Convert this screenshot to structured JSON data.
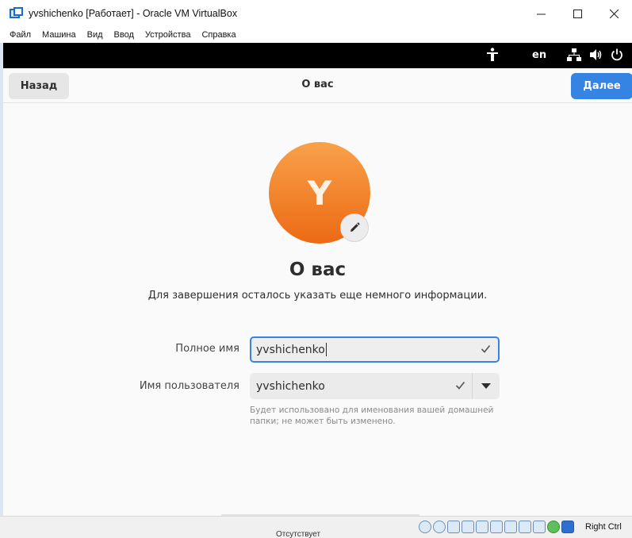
{
  "window": {
    "title": "yvshichenko [Работает] - Oracle VM VirtualBox",
    "controls": [
      "minimize",
      "maximize",
      "close"
    ]
  },
  "menubar": {
    "items": [
      "Файл",
      "Машина",
      "Вид",
      "Ввод",
      "Устройства",
      "Справка"
    ]
  },
  "topbar": {
    "language": "en",
    "icons": [
      "accessibility-icon",
      "network-icon",
      "volume-icon",
      "power-icon"
    ]
  },
  "header": {
    "back_label": "Назад",
    "title": "О вас",
    "next_label": "Далее"
  },
  "page": {
    "avatar_letter": "Y",
    "title": "О вас",
    "subtitle": "Для завершения осталось указать еще немного информации."
  },
  "form": {
    "full_name_label": "Полное имя",
    "full_name_value": "yvshichenko",
    "username_label": "Имя пользователя",
    "username_value": "yvshichenko",
    "username_hint": "Будет использовано для именования вашей домашней папки; не может быть изменено."
  },
  "statusbar": {
    "host_key": "Right Ctrl",
    "behind_text": "Отсутствует"
  },
  "colors": {
    "accent": "#3584e4",
    "avatar_top": "#f8a14a",
    "avatar_bottom": "#ec6a14"
  }
}
